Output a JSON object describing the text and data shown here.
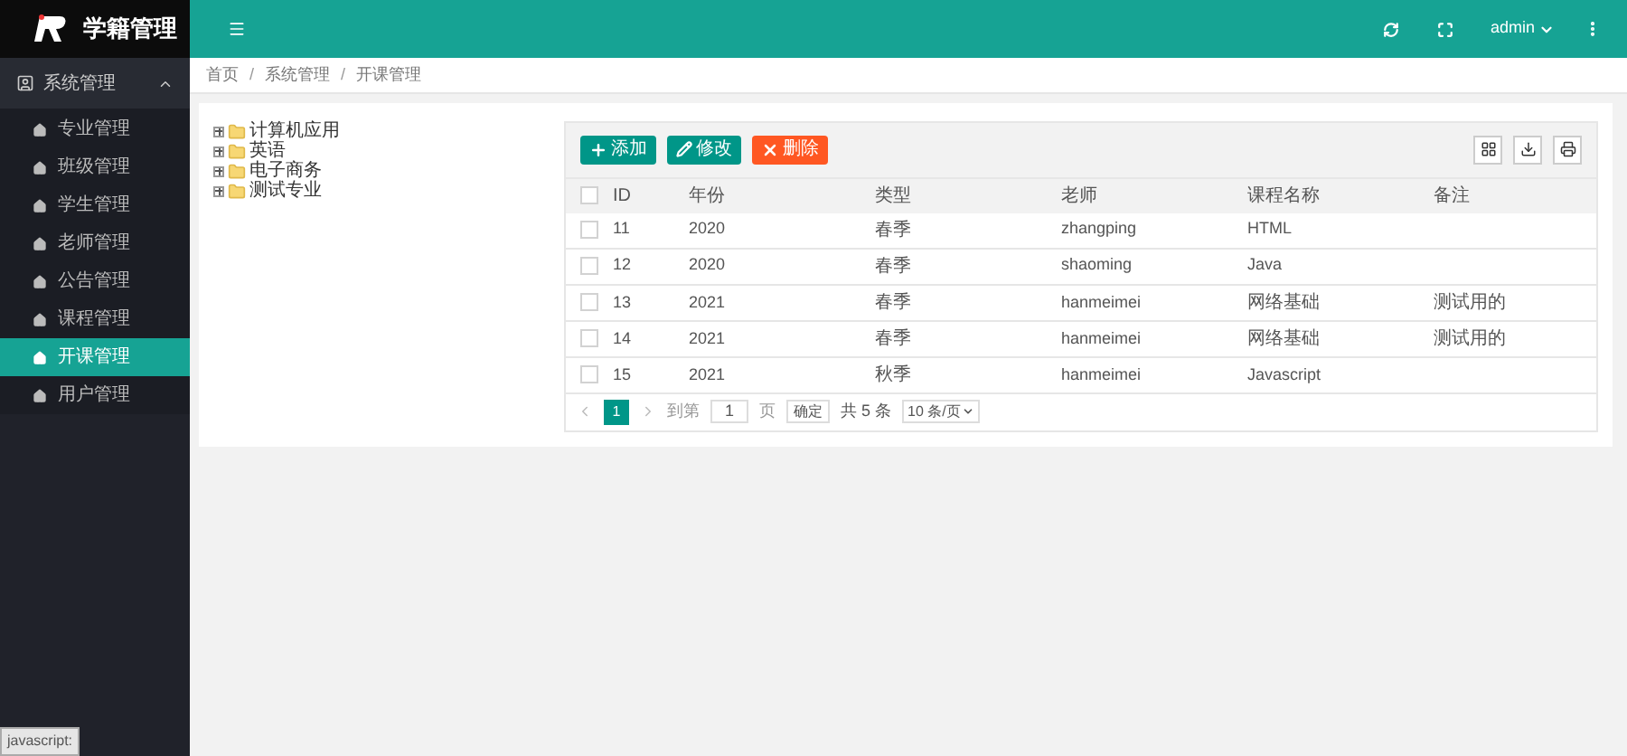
{
  "brand": {
    "title": "学籍管理"
  },
  "header": {
    "user": "admin"
  },
  "sidebar": {
    "section": {
      "label": "系统管理",
      "expanded": true
    },
    "items": [
      {
        "label": "专业管理",
        "selected": false
      },
      {
        "label": "班级管理",
        "selected": false
      },
      {
        "label": "学生管理",
        "selected": false
      },
      {
        "label": "老师管理",
        "selected": false
      },
      {
        "label": "公告管理",
        "selected": false
      },
      {
        "label": "课程管理",
        "selected": false
      },
      {
        "label": "开课管理",
        "selected": true
      },
      {
        "label": "用户管理",
        "selected": false
      }
    ]
  },
  "breadcrumb": {
    "separator": "/",
    "items": [
      "首页",
      "系统管理",
      "开课管理"
    ]
  },
  "tree": [
    {
      "label": "计算机应用",
      "expanded": false
    },
    {
      "label": "英语",
      "expanded": false
    },
    {
      "label": "电子商务",
      "expanded": false
    },
    {
      "label": "测试专业",
      "expanded": false
    }
  ],
  "toolbar": [
    {
      "kind": "add",
      "label": "添加"
    },
    {
      "kind": "edit",
      "label": "修改"
    },
    {
      "kind": "delete",
      "label": "删除"
    }
  ],
  "table": {
    "all_checked": false,
    "columns": [
      "ID",
      "年份",
      "类型",
      "老师",
      "课程名称",
      "备注"
    ],
    "rows": [
      {
        "checked": false,
        "cells": [
          "11",
          "2020",
          "春季",
          "zhangping",
          "HTML",
          ""
        ]
      },
      {
        "checked": false,
        "cells": [
          "12",
          "2020",
          "春季",
          "shaoming",
          "Java",
          ""
        ]
      },
      {
        "checked": false,
        "cells": [
          "13",
          "2021",
          "春季",
          "hanmeimei",
          "网络基础",
          "测试用的"
        ]
      },
      {
        "checked": false,
        "cells": [
          "14",
          "2021",
          "春季",
          "hanmeimei",
          "网络基础",
          "测试用的"
        ]
      },
      {
        "checked": false,
        "cells": [
          "15",
          "2021",
          "秋季",
          "hanmeimei",
          "Javascript",
          ""
        ]
      }
    ]
  },
  "pagination": {
    "pages": [
      {
        "label": "1",
        "selected": true
      }
    ],
    "goto_label": "到第",
    "goto_value": "1",
    "page_unit": "页",
    "confirm": "确定",
    "total": "共 5 条",
    "page_size": "10 条/页"
  },
  "status_bar": "javascript:"
}
